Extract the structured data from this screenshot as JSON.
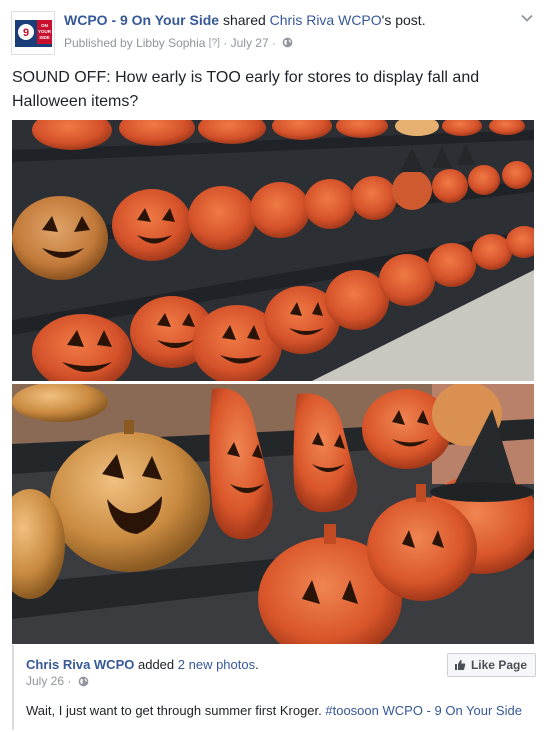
{
  "post": {
    "page_name": "WCPO - 9 On Your Side",
    "shared_text": "shared",
    "author_name": "Chris Riva WCPO",
    "author_suffix": "'s post.",
    "published_prefix": "Published by",
    "publisher": "Libby Sophia",
    "publisher_mark": "[?]",
    "separator": "·",
    "date": "July 27",
    "status_text": "SOUND OFF: How early is TOO early for stores to display fall and Halloween items?",
    "options_icon": "chevron-down-icon",
    "privacy_icon": "globe-icon"
  },
  "shared": {
    "author_name": "Chris Riva WCPO",
    "added_text": "added",
    "photos_link": "2 new photos",
    "period": ".",
    "date": "July 26",
    "separator": "·",
    "text_main": "Wait, I just want to get through summer first Kroger.",
    "hashtag": "#toosoon",
    "mention": "WCPO - 9 On Your Side",
    "like_button": "Like Page"
  },
  "logo": {
    "text": "ON YOUR SIDE",
    "number": "9"
  },
  "colors": {
    "link": "#365899",
    "meta": "#90949c",
    "pumpkin": "#d9562a",
    "shelf": "#2a2d31"
  }
}
